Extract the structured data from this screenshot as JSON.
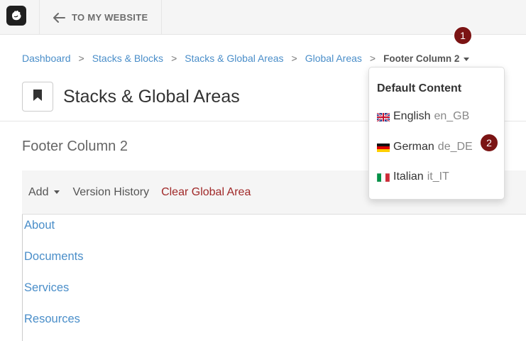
{
  "toolbar": {
    "back_label": "TO MY WEBSITE"
  },
  "breadcrumb": {
    "items": [
      "Dashboard",
      "Stacks & Blocks",
      "Stacks & Global Areas",
      "Global Areas"
    ],
    "separator": ">",
    "current": "Footer Column 2"
  },
  "badges": {
    "one": "1",
    "two": "2"
  },
  "page": {
    "title": "Stacks & Global Areas",
    "area_name": "Footer Column 2"
  },
  "area_toolbar": {
    "add_label": "Add",
    "version_history_label": "Version History",
    "clear_label": "Clear Global Area"
  },
  "content": {
    "links": [
      "About",
      "Documents",
      "Services",
      "Resources"
    ]
  },
  "dropdown": {
    "header": "Default Content",
    "items": [
      {
        "flag": "uk-flag-icon",
        "name": "English",
        "locale": "en_GB"
      },
      {
        "flag": "german-flag-icon",
        "name": "German",
        "locale": "de_DE"
      },
      {
        "flag": "italian-flag-icon",
        "name": "Italian",
        "locale": "it_IT"
      }
    ]
  },
  "colors": {
    "link": "#4a8ec9",
    "danger": "#a02828",
    "badge": "#7b1414"
  }
}
